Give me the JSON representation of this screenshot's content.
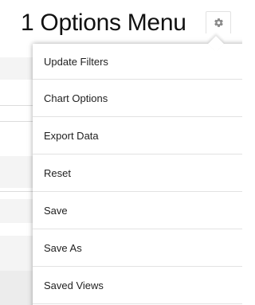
{
  "header": {
    "title": "1  Options Menu",
    "settings_icon": "gear-icon"
  },
  "menu": {
    "items": [
      {
        "label": "Update Filters"
      },
      {
        "label": "Chart Options"
      },
      {
        "label": "Export Data"
      },
      {
        "label": "Reset"
      },
      {
        "label": "Save"
      },
      {
        "label": "Save As"
      },
      {
        "label": "Saved Views"
      }
    ]
  },
  "colors": {
    "text": "#1f1f1f",
    "divider": "#e2e2e2",
    "gear": "#8a8a8a",
    "background_band": "#f4f4f4"
  }
}
